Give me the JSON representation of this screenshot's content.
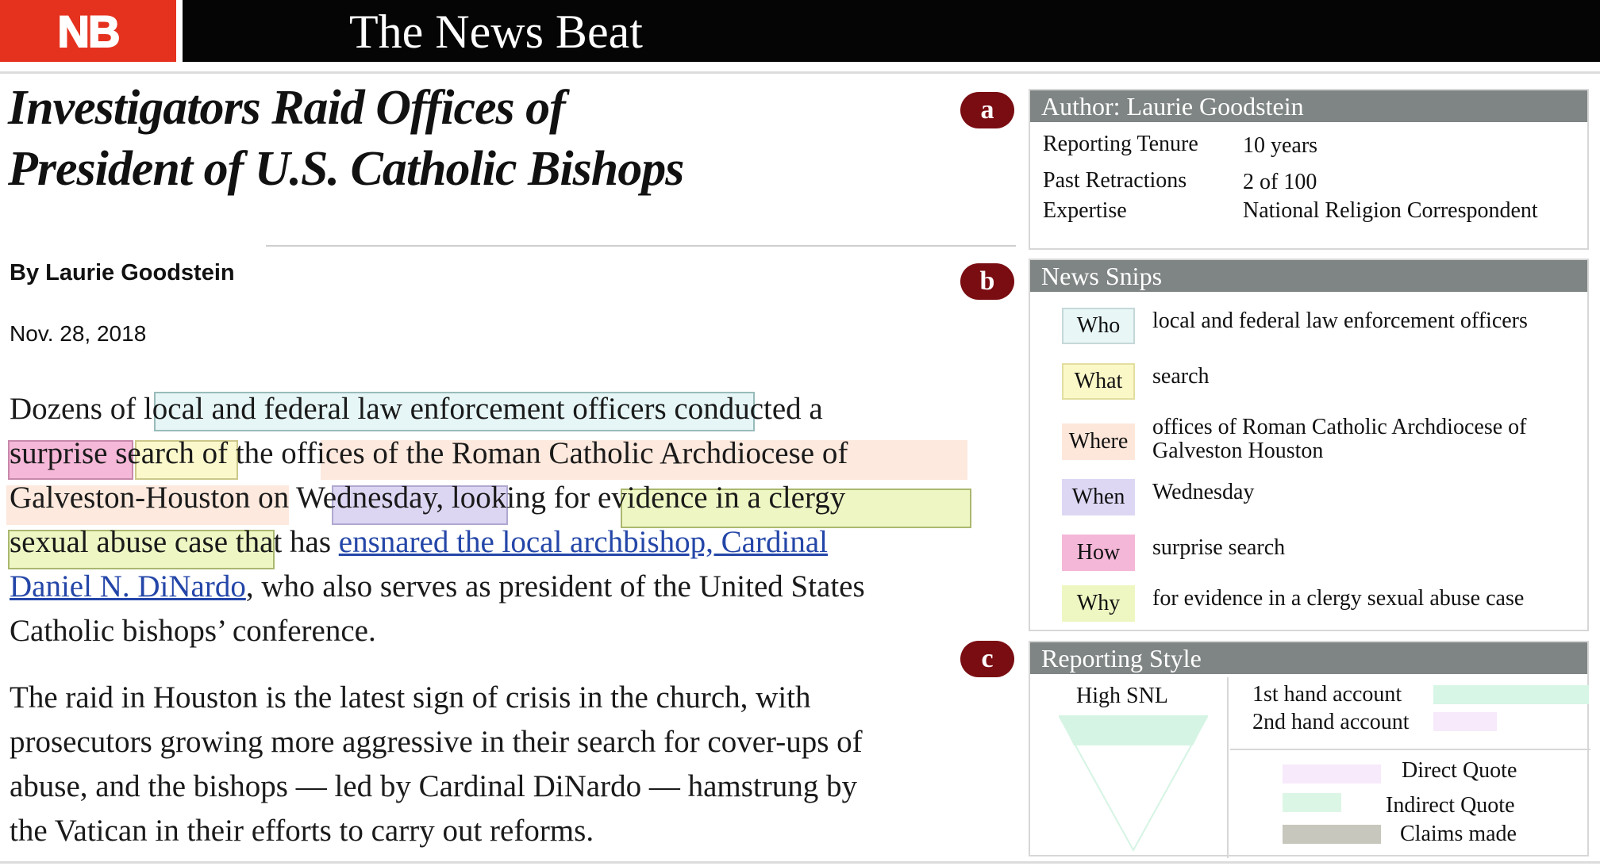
{
  "brand": {
    "logo": "NB",
    "name": "The News Beat"
  },
  "article": {
    "headline_line1": "Investigators Raid Offices of",
    "headline_line2": "President of U.S. Catholic Bishops",
    "byline": "By Laurie Goodstein",
    "date": "Nov. 28, 2018",
    "p1": {
      "t1": "Dozens of ",
      "who": "local and federal law enforcement officers",
      "t2": " conducted a",
      "how": "surprise",
      "t3": " ",
      "what": "search",
      "t4": " of the ",
      "where1": "offices of the Roman Catholic Archdiocese of",
      "where2": "Galveston-Houston",
      "t5": " on ",
      "when": "Wednesday,",
      "t6": " looking f",
      "why1": "or evidence in a clergy",
      "why2": "sexual abuse case",
      "t7": " that has ",
      "link1": "ensnared the local archbishop, Cardinal",
      "link2": "Daniel N. DiNardo",
      "t8": ", who also serves as president of the United States",
      "t9": "Catholic bishops’ conference."
    },
    "p2": [
      "The raid in Houston is the latest sign of crisis in the church, with",
      "prosecutors growing more aggressive in their search for cover-ups of",
      "abuse, and the bishops — led by Cardinal DiNardo — hamstrung by",
      "the Vatican in their efforts to carry out reforms."
    ]
  },
  "badges": {
    "a": "a",
    "b": "b",
    "c": "c"
  },
  "author_panel": {
    "title": "Author: Laurie Goodstein",
    "rows": [
      {
        "label": "Reporting Tenure",
        "value": "10 years"
      },
      {
        "label": "Past Retractions",
        "value": "2 of 100"
      },
      {
        "label": "Expertise",
        "value": "National Religion Correspondent"
      }
    ]
  },
  "snips_panel": {
    "title": "News Snips",
    "items": [
      {
        "key": "Who",
        "text": "local and federal law enforcement officers",
        "color": "#e8f6f6"
      },
      {
        "key": "What",
        "text": "search",
        "color": "#fbf8c8"
      },
      {
        "key": "Where",
        "text": "offices of Roman Catholic Archdiocese of",
        "text2": "Galveston Houston",
        "color": "#fde7da"
      },
      {
        "key": "When",
        "text": "Wednesday",
        "color": "#ddd7f4"
      },
      {
        "key": "How",
        "text": "surprise search",
        "color": "#f5b7d7"
      },
      {
        "key": "Why",
        "text": "for evidence in a clergy sexual abuse case",
        "color": "#eef7c2"
      }
    ]
  },
  "style_panel": {
    "title": "Reporting Style",
    "snl_label": "High SNL",
    "legend1": [
      {
        "label": "1st hand account",
        "color": "#d8f6e6"
      },
      {
        "label": "2nd hand account",
        "color": "#f7eafb"
      }
    ],
    "legend2": [
      {
        "label": "Direct Quote",
        "color": "#f7eafb"
      },
      {
        "label": "Indirect Quote",
        "color": "#dcf6e6"
      },
      {
        "label": "Claims made",
        "color": "#c8c7bd"
      }
    ]
  }
}
